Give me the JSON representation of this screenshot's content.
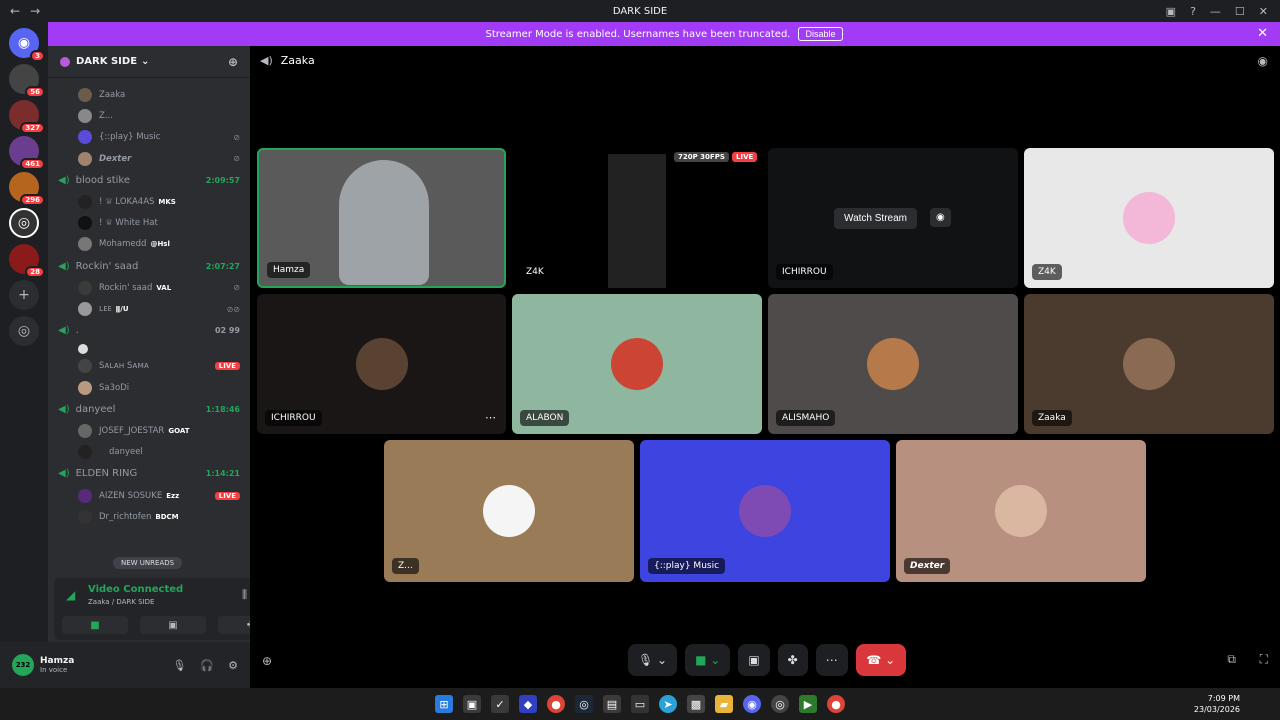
{
  "window": {
    "title": "DARK SIDE"
  },
  "banner": {
    "text": "Streamer Mode is enabled. Usernames have been truncated.",
    "button": "Disable"
  },
  "server_badges": [
    "3",
    "56",
    "327",
    "461",
    "296",
    "28"
  ],
  "sidebar": {
    "server_name": "DARK SIDE",
    "channels": [
      {
        "name": "",
        "users": [
          {
            "name": "Zaaka",
            "tag": ""
          },
          {
            "name": "Z...",
            "tag": ""
          },
          {
            "name": "{::play} Music",
            "tag": ""
          },
          {
            "name": "Dexter",
            "tag": ""
          }
        ]
      },
      {
        "name": "blood stike",
        "timer": "2:09:57",
        "users": [
          {
            "name": "! ♕ LOKA4AS",
            "tag": "MKS"
          },
          {
            "name": "! ♕ White Hat",
            "tag": ""
          },
          {
            "name": "Mohamedd",
            "tag": "@Hsl"
          }
        ]
      },
      {
        "name": "Rockin' saad",
        "timer": "2:07:27",
        "users": [
          {
            "name": "Rockin' saad",
            "tag": "VAL"
          },
          {
            "name": "ʟᴇᴇ",
            "tag": "ǁ/U"
          }
        ]
      },
      {
        "name": ".",
        "counts": "02  99",
        "users": [
          {
            "name": "",
            "tag": ""
          },
          {
            "name": "Sᴀʟᴀʜ Sᴀᴍᴀ",
            "tag": "",
            "live": "LIVE"
          },
          {
            "name": "Sa3oDi",
            "tag": ""
          }
        ]
      },
      {
        "name": "danyeel",
        "timer": "1:18:46",
        "users": [
          {
            "name": "JOSEF_JOESTAR",
            "tag": "GOAT"
          },
          {
            "name": "danyeel",
            "tag": ""
          }
        ]
      },
      {
        "name": "ELDEN RING",
        "timer": "1:14:21",
        "users": [
          {
            "name": "AIZEN SOSUKE",
            "tag": "Ezz",
            "live": "LIVE"
          },
          {
            "name": "Dr_richtofen",
            "tag": "BDCM"
          }
        ]
      }
    ],
    "new_unreads": "NEW UNREADS",
    "voice": {
      "status": "Video Connected",
      "location": "Zaaka / DARK SIDE"
    },
    "user": {
      "name": "Hamza",
      "status": "In voice",
      "avatar_text": "232"
    }
  },
  "stage": {
    "channel": "Zaaka",
    "tiles": [
      {
        "label": "Hamza"
      },
      {
        "label": "Z4K",
        "badge_res": "720P 30FPS",
        "badge_live": "LIVE"
      },
      {
        "label": "ICHIRROU",
        "watch": "Watch Stream"
      },
      {
        "label": "Z4K"
      },
      {
        "label": "ICHIRROU"
      },
      {
        "label": "ALABON"
      },
      {
        "label": "ALISMAHO"
      },
      {
        "label": "Zaaka"
      },
      {
        "label": "Z..."
      },
      {
        "label": "{::play} Music"
      },
      {
        "label": "Dexter"
      }
    ]
  },
  "taskbar": {
    "time": "7:09 PM",
    "date": "23/03/2026"
  },
  "colors": {
    "banner": "#a23bf5",
    "accent_green": "#23a55a",
    "hangup": "#da373c",
    "live": "#f23f43"
  }
}
